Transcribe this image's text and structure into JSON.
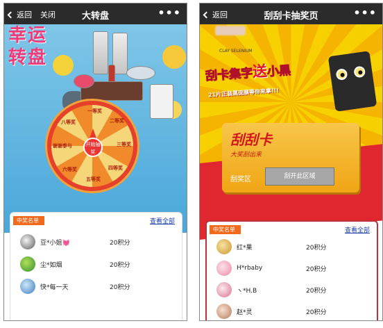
{
  "left": {
    "nav": {
      "back": "返回",
      "close": "关闭",
      "title": "大转盘",
      "more": "•••"
    },
    "hero_title_line1": "幸运",
    "hero_title_line2": "转盘",
    "wheel": {
      "hub": "开始抽奖",
      "prizes": [
        "一等奖",
        "二等奖",
        "三等奖",
        "四等奖",
        "五等奖",
        "六等奖",
        "谢谢参与",
        "八等奖"
      ]
    },
    "winners_tab": "中奖名单",
    "view_all": "查看全部",
    "winners": [
      {
        "name": "豆*小姐💓",
        "points": "20积分"
      },
      {
        "name": "尘*如烟",
        "points": "20积分"
      },
      {
        "name": "快*每一天",
        "points": "20积分"
      }
    ]
  },
  "right": {
    "nav": {
      "back": "返回",
      "title": "刮刮卡抽奖页",
      "more": "•••"
    },
    "brand": "CLAY SELENIUM",
    "headline_part1": "刮卡集字",
    "headline_part2": "送",
    "headline_part3": "小黑",
    "subline": "21片正装黑面膜等你来拿!!!",
    "scroll_title": "刮刮卡",
    "scroll_sub": "大奖刮出来",
    "scratch_label": "刮奖区",
    "scratch_button": "刮开此区域",
    "winners_tab": "中奖名单",
    "view_all": "查看全部",
    "winners": [
      {
        "name": "红*果",
        "points": "20积分"
      },
      {
        "name": "H*rbaby",
        "points": "20积分"
      },
      {
        "name": "ヽ*H.B",
        "points": "20积分"
      },
      {
        "name": "赵*灵",
        "points": "20积分"
      }
    ]
  },
  "colors": {
    "accent_orange": "#f26b1d",
    "link_blue": "#1d3fae",
    "title_pink": "#f23a78",
    "red": "#e0262f",
    "yellow": "#f7d000"
  }
}
